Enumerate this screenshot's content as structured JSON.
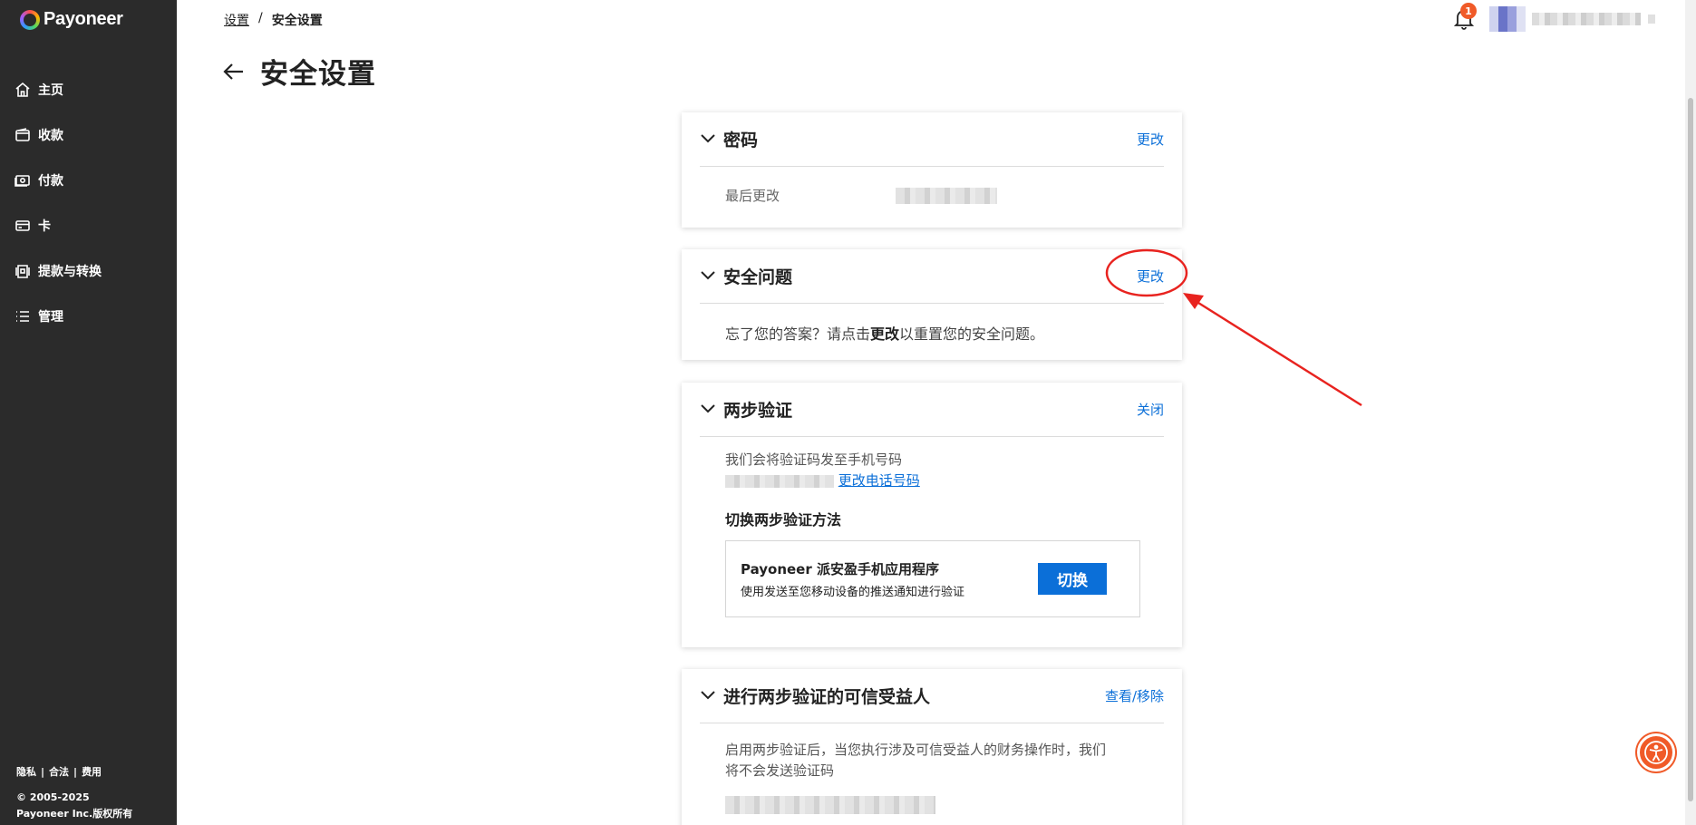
{
  "app": {
    "brand": "Payoneer"
  },
  "sidebar": {
    "items": [
      {
        "label": "主页",
        "icon": "home-icon"
      },
      {
        "label": "收款",
        "icon": "wallet-icon"
      },
      {
        "label": "付款",
        "icon": "cash-icon"
      },
      {
        "label": "卡",
        "icon": "card-icon"
      },
      {
        "label": "提款与转换",
        "icon": "withdraw-icon"
      },
      {
        "label": "管理",
        "icon": "list-icon"
      }
    ],
    "footer": {
      "privacy": "隐私",
      "legal": "合法",
      "fees": "费用",
      "separator": "|",
      "copyright_line1": "© 2005-2025",
      "copyright_line2": "Payoneer Inc.版权所有"
    }
  },
  "header": {
    "breadcrumb_parent": "设置",
    "breadcrumb_separator": "/",
    "breadcrumb_current": "安全设置",
    "page_title": "安全设置",
    "notification_count": "1"
  },
  "cards": {
    "password": {
      "title": "密码",
      "action": "更改",
      "last_changed_label": "最后更改"
    },
    "security_question": {
      "title": "安全问题",
      "action": "更改",
      "text_before": "忘了您的答案？请点击",
      "text_bold": "更改",
      "text_after": "以重置您的安全问题。"
    },
    "two_step": {
      "title": "两步验证",
      "action": "关闭",
      "intro": "我们会将验证码发至手机号码",
      "change_phone": "更改电话号码",
      "switch_heading": "切换两步验证方法",
      "method_title": "Payoneer 派安盈手机应用程序",
      "method_desc": "使用发送至您移动设备的推送通知进行验证",
      "switch_button": "切换"
    },
    "trusted": {
      "title": "进行两步验证的可信受益人",
      "action": "查看/移除",
      "desc_line1": "启用两步验证后，当您执行涉及可信受益人的财务操作时，我们",
      "desc_line2": "将不会发送验证码"
    }
  },
  "colors": {
    "sidebar_bg": "#2b2b2b",
    "link_blue": "#0b6fd8",
    "badge_orange": "#f05a28",
    "annotation_red": "#e8231f"
  }
}
